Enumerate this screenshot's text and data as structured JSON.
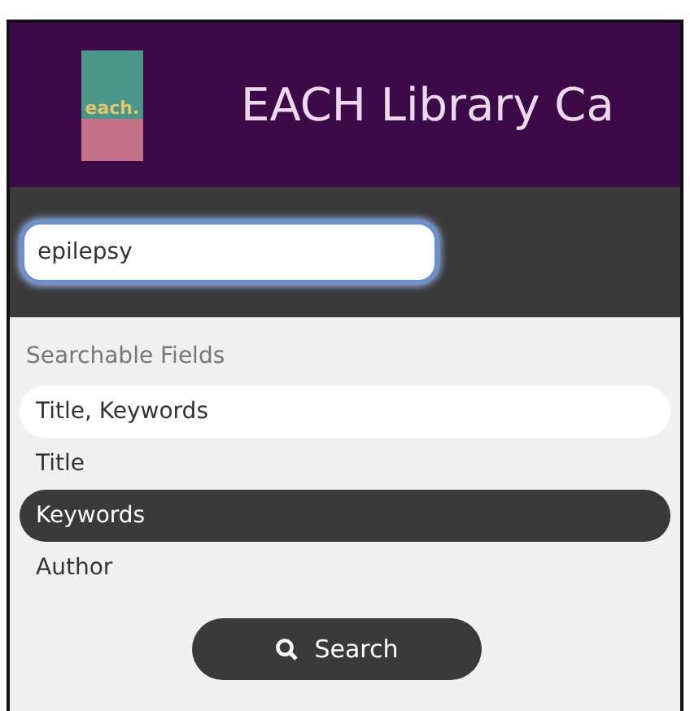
{
  "header": {
    "logo_text": "each.",
    "title": "EACH Library Ca"
  },
  "search": {
    "value": "epilepsy",
    "focused": true
  },
  "fields": {
    "heading": "Searchable Fields",
    "items": [
      {
        "label": "Title, Keywords",
        "selected": false,
        "hovered": true
      },
      {
        "label": "Title",
        "selected": false,
        "hovered": false
      },
      {
        "label": "Keywords",
        "selected": true,
        "hovered": false
      },
      {
        "label": "Author",
        "selected": false,
        "hovered": false
      }
    ]
  },
  "button": {
    "label": "Search"
  }
}
